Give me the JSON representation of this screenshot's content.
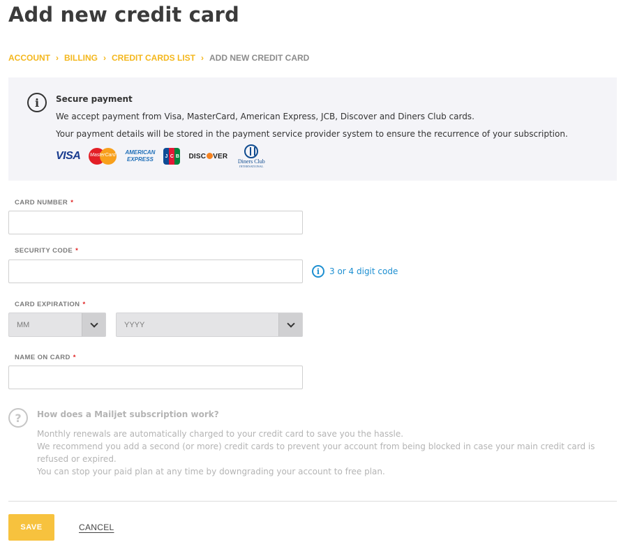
{
  "page": {
    "title": "Add new credit card"
  },
  "breadcrumb": {
    "items": [
      "ACCOUNT",
      "BILLING",
      "CREDIT CARDS LIST"
    ],
    "current": "ADD NEW CREDIT CARD",
    "separator": "›"
  },
  "secure_panel": {
    "icon": "info-icon",
    "title": "Secure payment",
    "line1": "We accept payment from Visa, MasterCard, American Express, JCB, Discover and Diners Club cards.",
    "line2": "Your payment details will be stored in the payment service provider system to ensure the recurrence of your subscription.",
    "logos": {
      "visa": "VISA",
      "mastercard": "MasterCard",
      "amex_1": "AMERICAN",
      "amex_2": "EXPRESS",
      "jcb": "JCB",
      "discover_a": "DISC",
      "discover_b": "VER",
      "diners_1": "Diners Club",
      "diners_2": "INTERNATIONAL"
    }
  },
  "form": {
    "card_number": {
      "label": "CARD NUMBER",
      "required": "*",
      "value": ""
    },
    "security_code": {
      "label": "SECURITY CODE",
      "required": "*",
      "value": "",
      "hint": "3 or 4 digit code"
    },
    "expiration": {
      "label": "CARD EXPIRATION",
      "required": "*",
      "month": "MM",
      "year": "YYYY"
    },
    "name_on_card": {
      "label": "NAME ON CARD",
      "required": "*",
      "value": ""
    }
  },
  "help": {
    "icon": "question-icon",
    "title": "How does a Mailjet subscription work?",
    "line1": "Monthly renewals are automatically charged to your credit card to save you the hassle.",
    "line2": "We recommend you add a second (or more) credit cards to prevent your account from being blocked in case your main credit card is refused or expired.",
    "line3": "You can stop your paid plan at any time by downgrading your account to free plan."
  },
  "actions": {
    "save": "SAVE",
    "cancel": "CANCEL"
  },
  "colors": {
    "accent": "#f4b71d",
    "link": "#1d8fd1",
    "required": "#e02020",
    "panel_bg": "#f4f4f8"
  }
}
